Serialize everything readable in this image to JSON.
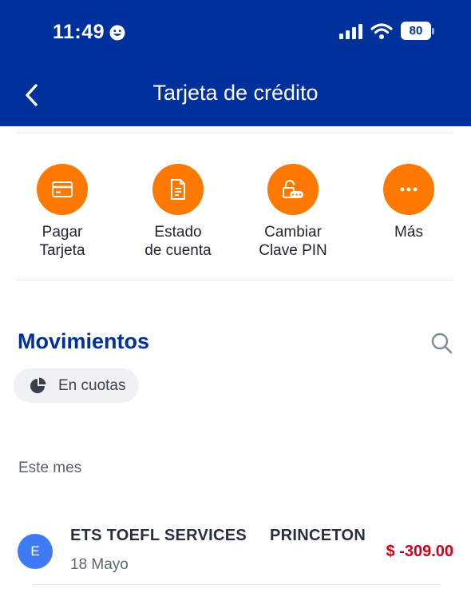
{
  "status_bar": {
    "time": "11:49",
    "battery": "80",
    "icons": [
      "smiley-status-icon",
      "signal-icon",
      "wifi-icon",
      "battery-icon"
    ]
  },
  "header": {
    "title": "Tarjeta de crédito",
    "back_icon": "chevron-left-icon",
    "background": "#00309c"
  },
  "actions": [
    {
      "line1": "Pagar",
      "line2": "Tarjeta",
      "icon": "card-icon"
    },
    {
      "line1": "Estado",
      "line2": "de cuenta",
      "icon": "document-icon"
    },
    {
      "line1": "Cambiar",
      "line2": "Clave PIN",
      "icon": "unlock-pin-icon"
    },
    {
      "line1": "Más",
      "line2": "",
      "icon": "more-dots-icon"
    }
  ],
  "accent_color": "#ff7800",
  "movements": {
    "title": "Movimientos",
    "search_icon": "search-icon",
    "chip_label": "En cuotas",
    "period_label": "Este mes",
    "transactions": [
      {
        "avatar": "E",
        "merchant": "ETS TOEFL SERVICES",
        "city": "PRINCETON",
        "date": "18 Mayo",
        "amount": "$ -309.00",
        "amount_color": "#d0021b"
      }
    ]
  }
}
